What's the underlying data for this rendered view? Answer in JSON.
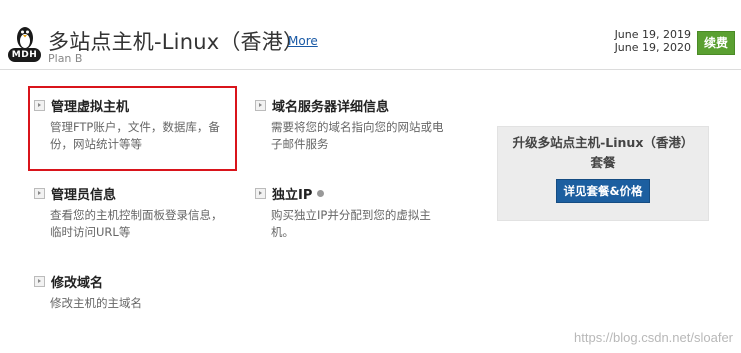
{
  "header": {
    "logo_text": "MDH",
    "title": "多站点主机-Linux（香港）",
    "more_link": "More",
    "plan": "Plan B",
    "date_start": "June 19, 2019",
    "date_end": "June 19, 2020",
    "renew_button": "续费"
  },
  "items": [
    {
      "title": "管理虚拟主机",
      "desc_line1": "管理FTP账户，文件，数据库，备",
      "desc_line2": "份，网站统计等等"
    },
    {
      "title": "域名服务器详细信息",
      "desc_line1": "需要将您的域名指向您的网站或电",
      "desc_line2": "子邮件服务"
    },
    {
      "title": "管理员信息",
      "desc_line1": "查看您的主机控制面板登录信息，",
      "desc_line2": "临时访问URL等"
    },
    {
      "title": "独立IP",
      "desc_line1": "购买独立IP并分配到您的虚拟主",
      "desc_line2": "机。"
    },
    {
      "title": "修改域名",
      "desc_line1": "修改主机的主域名",
      "desc_line2": ""
    }
  ],
  "upgrade": {
    "title_line1": "升级多站点主机-Linux（香港）",
    "title_line2": "套餐",
    "button": "详见套餐&价格"
  },
  "watermark": "https://blog.csdn.net/sloafer",
  "colors": {
    "accent": "#1c5fa0",
    "renew": "#5aa031",
    "highlight": "#d9141b"
  }
}
